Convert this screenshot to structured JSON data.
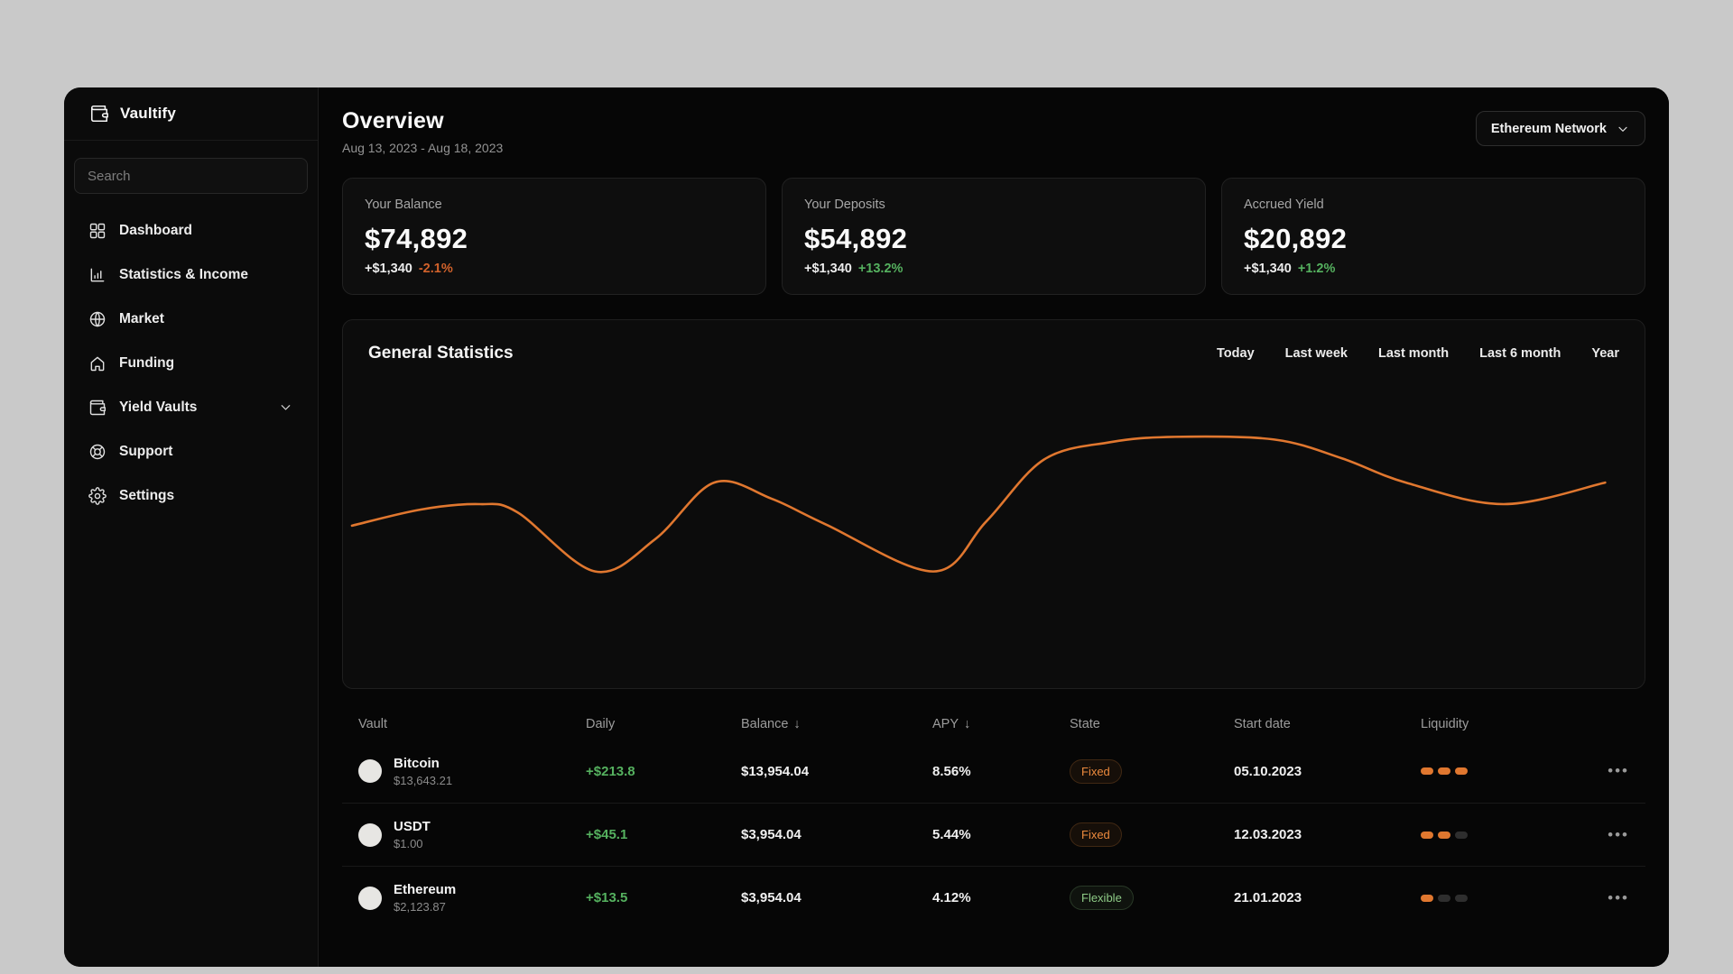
{
  "brand": {
    "name": "Vaultify",
    "logo_icon": "wallet-icon"
  },
  "search": {
    "placeholder": "Search"
  },
  "sidebar": {
    "items": [
      {
        "label": "Dashboard",
        "icon": "grid-icon",
        "chevron": false
      },
      {
        "label": "Statistics & Income",
        "icon": "bar-chart-icon",
        "chevron": false
      },
      {
        "label": "Market",
        "icon": "globe-icon",
        "chevron": false
      },
      {
        "label": "Funding",
        "icon": "home-icon",
        "chevron": false
      },
      {
        "label": "Yield Vaults",
        "icon": "wallet-icon",
        "chevron": true
      },
      {
        "label": "Support",
        "icon": "lifebuoy-icon",
        "chevron": false
      },
      {
        "label": "Settings",
        "icon": "gear-icon",
        "chevron": false
      }
    ]
  },
  "header": {
    "title": "Overview",
    "date_range": "Aug 13, 2023 - Aug 18, 2023",
    "network_selector": "Ethereum Network"
  },
  "cards": [
    {
      "label": "Your Balance",
      "value": "$74,892",
      "delta_amount": "+$1,340",
      "delta_pct": "-2.1%",
      "delta_direction": "neg"
    },
    {
      "label": "Your Deposits",
      "value": "$54,892",
      "delta_amount": "+$1,340",
      "delta_pct": "+13.2%",
      "delta_direction": "pos"
    },
    {
      "label": "Accrued Yield",
      "value": "$20,892",
      "delta_amount": "+$1,340",
      "delta_pct": "+1.2%",
      "delta_direction": "pos"
    }
  ],
  "chart": {
    "title": "General Statistics",
    "filters": [
      "Today",
      "Last week",
      "Last month",
      "Last 6 month",
      "Year"
    ]
  },
  "chart_data": {
    "type": "line",
    "title": "General Statistics",
    "xlabel": "",
    "ylabel": "",
    "axes_visible": false,
    "grid": false,
    "legend": "none",
    "line_color": "#e0772f",
    "x_range_label": "Aug 13, 2023 - Aug 18, 2023",
    "series": [
      {
        "name": "General Statistics",
        "points_normalized_x_0to1_y_0to1": [
          [
            0.0,
            0.34
          ],
          [
            0.055,
            0.46
          ],
          [
            0.102,
            0.5
          ],
          [
            0.132,
            0.44
          ],
          [
            0.194,
            0.0
          ],
          [
            0.242,
            0.24
          ],
          [
            0.289,
            0.66
          ],
          [
            0.335,
            0.54
          ],
          [
            0.378,
            0.35
          ],
          [
            0.464,
            0.0
          ],
          [
            0.506,
            0.37
          ],
          [
            0.552,
            0.83
          ],
          [
            0.605,
            0.96
          ],
          [
            0.657,
            1.0
          ],
          [
            0.736,
            0.98
          ],
          [
            0.79,
            0.84
          ],
          [
            0.841,
            0.66
          ],
          [
            0.919,
            0.5
          ],
          [
            1.0,
            0.66
          ]
        ]
      }
    ]
  },
  "table": {
    "columns": [
      {
        "label": "Vault",
        "sort": ""
      },
      {
        "label": "Daily",
        "sort": ""
      },
      {
        "label": "Balance",
        "sort": "↓"
      },
      {
        "label": "APY",
        "sort": "↓"
      },
      {
        "label": "State",
        "sort": ""
      },
      {
        "label": "Start date",
        "sort": ""
      },
      {
        "label": "Liquidity",
        "sort": ""
      }
    ],
    "rows": [
      {
        "name": "Bitcoin",
        "price": "$13,643.21",
        "daily": "+$213.8",
        "balance": "$13,954.04",
        "apy": "8.56%",
        "state": "Fixed",
        "state_style": "fixed",
        "start_date": "05.10.2023",
        "liquidity_filled": 3,
        "liquidity_total": 3,
        "menu": "•••"
      },
      {
        "name": "USDT",
        "price": "$1.00",
        "daily": "+$45.1",
        "balance": "$3,954.04",
        "apy": "5.44%",
        "state": "Fixed",
        "state_style": "fixed",
        "start_date": "12.03.2023",
        "liquidity_filled": 2,
        "liquidity_total": 3,
        "menu": "•••"
      },
      {
        "name": "Ethereum",
        "price": "$2,123.87",
        "daily": "+$13.5",
        "balance": "$3,954.04",
        "apy": "4.12%",
        "state": "Flexible",
        "state_style": "flexible",
        "start_date": "21.01.2023",
        "liquidity_filled": 1,
        "liquidity_total": 3,
        "menu": "•••"
      }
    ]
  },
  "colors": {
    "accent_orange": "#e0772f",
    "negative_orange": "#d2622b",
    "positive_green": "#55b15f",
    "badge_fixed_text": "#ec8a3d",
    "badge_flexible_text": "#8ecb86",
    "pill_empty": "#2e2e2e",
    "avatar_bg": "#e7e6e3"
  }
}
